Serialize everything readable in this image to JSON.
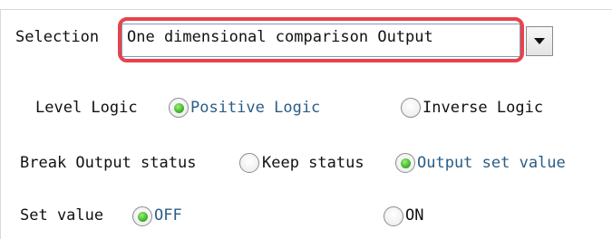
{
  "selection": {
    "label": "Selection",
    "value": "One dimensional comparison Output"
  },
  "level_logic": {
    "label": "Level Logic",
    "options": [
      {
        "label": "Positive Logic",
        "selected": true
      },
      {
        "label": "Inverse Logic",
        "selected": false
      }
    ]
  },
  "break_output": {
    "label": "Break Output status",
    "options": [
      {
        "label": "Keep status",
        "selected": false
      },
      {
        "label": "Output set value",
        "selected": true
      }
    ]
  },
  "set_value": {
    "label": "Set value",
    "options": [
      {
        "label": "OFF",
        "selected": true
      },
      {
        "label": "ON",
        "selected": false
      }
    ]
  },
  "colors": {
    "highlight": "#e8424b",
    "selected_text": "#2a5d86",
    "radio_selected": "#3fb52b"
  }
}
